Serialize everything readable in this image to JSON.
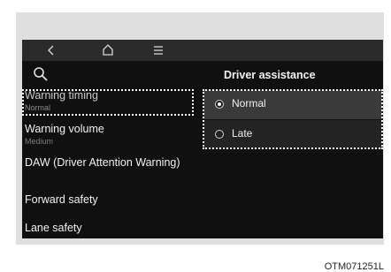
{
  "topbar": {
    "back_icon": "chevron-left-icon",
    "home_icon": "home-icon",
    "menu_icon": "menu-icon"
  },
  "search": {
    "icon": "search-icon"
  },
  "header": {
    "title": "Driver assistance"
  },
  "left_menu": {
    "items": [
      {
        "label": "Warning timing",
        "sub": "Normal"
      },
      {
        "label": "Warning volume",
        "sub": "Medium"
      },
      {
        "label": "DAW (Driver Attention Warning)"
      },
      {
        "label": "Forward safety"
      },
      {
        "label": "Lane safety"
      }
    ]
  },
  "options": {
    "items": [
      {
        "label": "Normal",
        "selected": true
      },
      {
        "label": "Late",
        "selected": false
      }
    ]
  },
  "caption": "OTM071251L",
  "colors": {
    "screen_bg": "#101010",
    "topbar_bg": "#2b2b2b",
    "selected_option_bg": "#3a3a3a",
    "highlight_border": "#ffffff"
  }
}
